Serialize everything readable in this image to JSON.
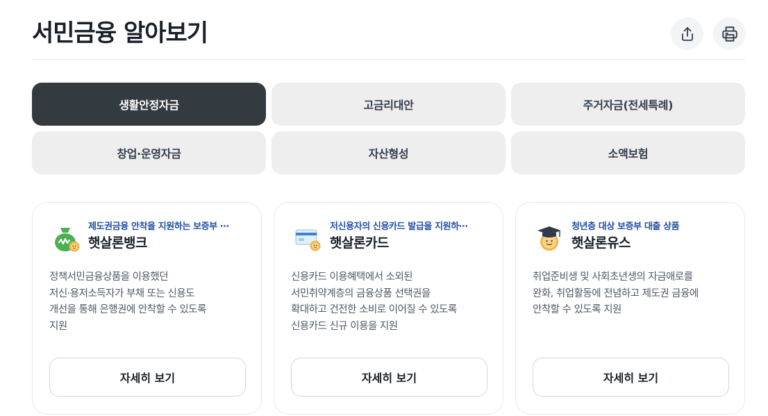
{
  "header": {
    "title": "서민금융 알아보기",
    "share_icon": "share-icon",
    "print_icon": "printer-icon"
  },
  "tabs": [
    {
      "label": "생활안정자금",
      "active": true
    },
    {
      "label": "고금리대안",
      "active": false
    },
    {
      "label": "주거자금(전세특례)",
      "active": false
    },
    {
      "label": "창업·운영자금",
      "active": false
    },
    {
      "label": "자산형성",
      "active": false
    },
    {
      "label": "소액보험",
      "active": false
    }
  ],
  "cards": [
    {
      "icon": "money-bag-sun-icon",
      "subtitle": "제도권금융 안착을 지원하는 보증부 ⋯",
      "name": "햇살론뱅크",
      "desc": [
        "정책서민금융상품을 이용했던",
        "저신·용저소득자가 부채 또는 신용도",
        "개선을 통해 은행권에 안착할 수 있도록",
        "지원"
      ],
      "button": "자세히 보기"
    },
    {
      "icon": "credit-card-sun-icon",
      "subtitle": "저신용자의 신용카드 발급을 지원하⋯",
      "name": "햇살론카드",
      "desc": [
        "신용카드 이용혜택에서 소외된",
        "서민취약계층의 금융상품 선택권을",
        "확대하고 건전한 소비로 이어질 수 있도록",
        "신용카드 신규 이용을 지원"
      ],
      "button": "자세히 보기"
    },
    {
      "icon": "graduation-cap-sun-icon",
      "subtitle": "청년층 대상 보증부 대출 상품",
      "name": "햇살론유스",
      "desc": [
        "취업준비생 및 사회초년생의 자금애로를",
        "완화, 취업활동에 전념하고 제도권 금융에",
        "안착할 수 있도록 지원"
      ],
      "button": "자세히 보기"
    }
  ],
  "colors": {
    "active_tab": "#333a40",
    "tab": "#eeeeee",
    "subtitle": "#1f4fa3"
  }
}
